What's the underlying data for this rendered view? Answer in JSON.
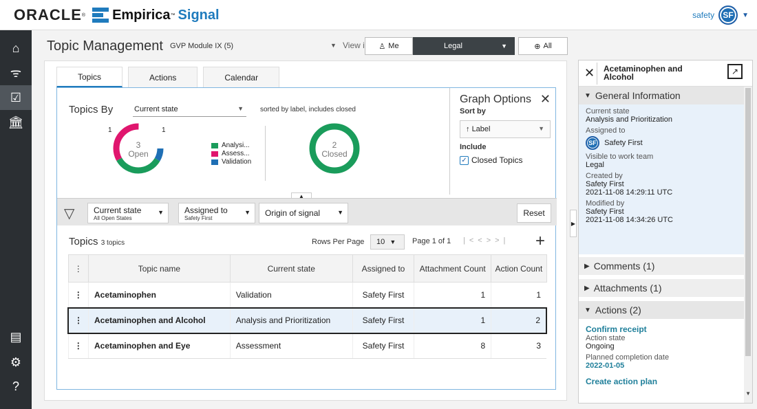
{
  "header": {
    "oracle": "ORACLE",
    "product": "Empirica",
    "product_accent": "Signal",
    "user_name": "safety",
    "user_initials": "SF"
  },
  "nav": {
    "icons": [
      "home-icon",
      "wifi-icon",
      "folder-check-icon",
      "bank-icon",
      "document-icon",
      "settings-icon",
      "help-icon"
    ]
  },
  "page": {
    "title": "Topic Management",
    "module": "GVP Module IX (5)",
    "view_items_for": "View items for",
    "filters": {
      "me": "Me",
      "legal": "Legal",
      "all": "All"
    }
  },
  "tabs": [
    "Topics",
    "Actions",
    "Calendar"
  ],
  "summary": {
    "topics_by": "Topics By",
    "group_by": "Current state",
    "sorted_note": "sorted by label, includes closed",
    "open_count": "3",
    "open_label": "Open",
    "closed_count": "2",
    "closed_label": "Closed",
    "donut_labels": {
      "top_left": "1",
      "top_right": "1"
    },
    "legend": [
      {
        "label": "Analysi...",
        "color": "#1a9c5b"
      },
      {
        "label": "Assess...",
        "color": "#e0166e"
      },
      {
        "label": "Validation",
        "color": "#1f6fb5"
      }
    ]
  },
  "graph_options": {
    "title": "Graph Options",
    "sort_by_label": "Sort by",
    "sort_value": "Label",
    "include_label": "Include",
    "closed_topics": "Closed Topics"
  },
  "filter_bar": {
    "current_state": "Current state",
    "current_state_value": "All Open States",
    "assigned_to": "Assigned to",
    "assigned_to_value": "Safety First",
    "origin": "Origin of signal",
    "reset": "Reset"
  },
  "list": {
    "title": "Topics",
    "count": "3 topics",
    "rows_per_page": "Rows Per Page",
    "rows_value": "10",
    "page_info": "Page 1 of 1",
    "columns": [
      "Topic name",
      "Current state",
      "Assigned to",
      "Attachment Count",
      "Action Count"
    ],
    "rows": [
      {
        "name": "Acetaminophen",
        "state": "Validation",
        "assigned": "Safety First",
        "attachments": "1",
        "actions": "1"
      },
      {
        "name": "Acetaminophen and Alcohol",
        "state": "Analysis and Prioritization",
        "assigned": "Safety First",
        "attachments": "1",
        "actions": "2"
      },
      {
        "name": "Acetaminophen and Eye",
        "state": "Assessment",
        "assigned": "Safety First",
        "attachments": "8",
        "actions": "3"
      }
    ]
  },
  "detail": {
    "title": "Acetaminophen and Alcohol",
    "general": "General Information",
    "current_state_k": "Current state",
    "current_state_v": "Analysis and Prioritization",
    "assigned_k": "Assigned to",
    "assigned_v": "Safety First",
    "assigned_initials": "SF",
    "visible_k": "Visible to work team",
    "visible_v": "Legal",
    "created_k": "Created by",
    "created_by": "Safety First",
    "created_at": "2021-11-08 14:29:11 UTC",
    "modified_k": "Modified by",
    "modified_by": "Safety First",
    "modified_at": "2021-11-08 14:34:26 UTC",
    "comments": "Comments (1)",
    "attachments": "Attachments (1)",
    "actions": "Actions (2)",
    "action1_title": "Confirm receipt",
    "action_state_k": "Action state",
    "action_state_v": "Ongoing",
    "planned_k": "Planned completion date",
    "planned_v": "2022-01-05",
    "action2_title": "Create action plan"
  }
}
